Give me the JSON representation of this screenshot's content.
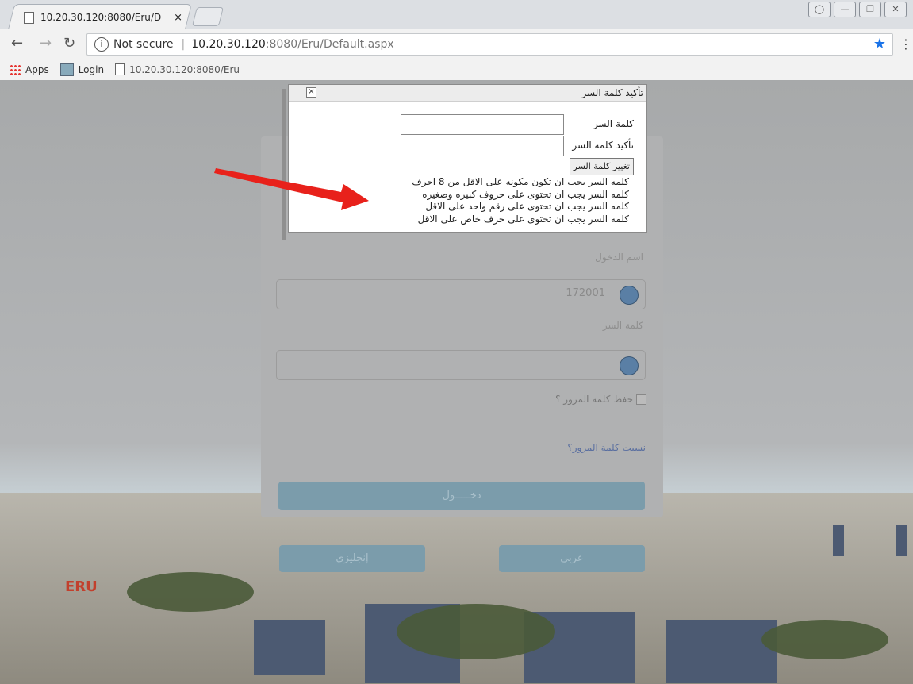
{
  "browser": {
    "tab_title": "10.20.30.120:8080/Eru/D",
    "tab_close": "×",
    "url_security": "Not secure",
    "url_host": "10.20.30.120",
    "url_path": ":8080/Eru/Default.aspx",
    "bookmarks": [
      "Apps",
      "Login",
      "10.20.30.120:8080/Eru"
    ]
  },
  "login": {
    "username_label": "اسم الدخول",
    "username_value": "172001",
    "password_label": "كلمة السر",
    "remember_label": "حفظ كلمة المرور ؟",
    "forgot_link": "نسيت كلمة المرور؟",
    "login_button": "دخـــــول",
    "english_button": "إنجليزى",
    "arabic_button": "عربى"
  },
  "modal": {
    "title": "تأكيد كلمة السر",
    "close": "×",
    "password_label": "كلمة السر",
    "confirm_label": "تأكيد كلمة السر",
    "change_button": "تغيير كلمة السر",
    "rules": [
      "كلمه السر يجب ان تكون مكونه على الاقل من 8 احرف",
      "كلمه السر يجب ان تحتوى على حروف كبيره وصغيره",
      "كلمه السر يجب ان تحتوى على رقم واحد على الاقل",
      "كلمه السر يجب ان تحتوى على حرف خاص على الاقل"
    ]
  },
  "background": {
    "logo_text": "ERU"
  },
  "colors": {
    "arrow": "#e8211b",
    "accent": "#7b9cab"
  }
}
